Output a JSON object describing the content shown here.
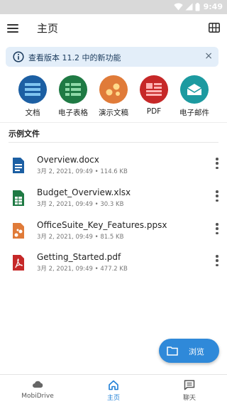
{
  "status_bar": {
    "time": "9:49"
  },
  "app_bar": {
    "title": "主页"
  },
  "banner": {
    "text": "查看版本 11.2 中的新功能",
    "close": "×"
  },
  "apps": [
    {
      "label": "文档",
      "color": "#1c5fa3",
      "icon": "document-icon"
    },
    {
      "label": "电子表格",
      "color": "#1f7a44",
      "icon": "spreadsheet-icon"
    },
    {
      "label": "演示文稿",
      "color": "#e07b39",
      "icon": "presentation-icon"
    },
    {
      "label": "PDF",
      "color": "#c62828",
      "icon": "pdf-icon"
    },
    {
      "label": "电子邮件",
      "color": "#1c9aa0",
      "icon": "mail-icon"
    }
  ],
  "section_title": "示例文件",
  "files": [
    {
      "name": "Overview.docx",
      "date": "3月 2, 2021, 09:49",
      "size": "114.6 KB",
      "type": "docx",
      "color": "#1c5fa3"
    },
    {
      "name": "Budget_Overview.xlsx",
      "date": "3月 2, 2021, 09:49",
      "size": "30.3 KB",
      "type": "xlsx",
      "color": "#1f7a44"
    },
    {
      "name": "OfficeSuite_Key_Features.ppsx",
      "date": "3月 2, 2021, 09:49",
      "size": "81.5 KB",
      "type": "ppsx",
      "color": "#e07b39"
    },
    {
      "name": "Getting_Started.pdf",
      "date": "3月 2, 2021, 09:49",
      "size": "477.2 KB",
      "type": "pdf",
      "color": "#c62828"
    }
  ],
  "fab": {
    "label": "浏览"
  },
  "bottom_nav": [
    {
      "label": "MobiDrive",
      "icon": "cloud-icon",
      "active": false
    },
    {
      "label": "主页",
      "icon": "home-icon",
      "active": true
    },
    {
      "label": "聊天",
      "icon": "chat-icon",
      "active": false
    }
  ]
}
